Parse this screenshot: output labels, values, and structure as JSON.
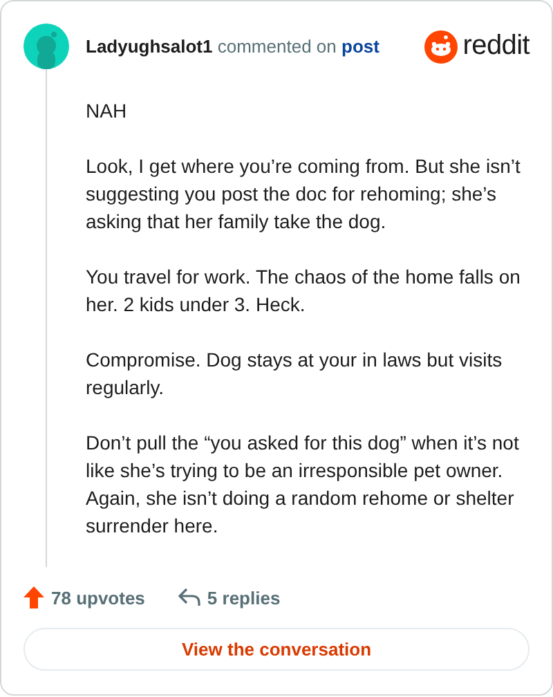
{
  "comment": {
    "author": "Ladyughsalot1",
    "action": "commented on",
    "target": "post",
    "paragraphs": [
      "NAH",
      "Look, I get where you’re coming from. But she isn’t suggesting you post the doc for rehoming; she’s asking that her family take the dog.",
      "You travel for work. The chaos of the home falls on her. 2 kids under 3. Heck.",
      "Compromise. Dog stays at your in laws but visits regularly.",
      "Don’t pull the “you asked for this dog” when it’s not like she’s trying to be an irresponsible pet owner. Again, she isn’t doing a random rehome or shelter surrender here."
    ],
    "upvotes": "78 upvotes",
    "replies": "5 replies"
  },
  "brand": "reddit",
  "button": "View the conversation"
}
